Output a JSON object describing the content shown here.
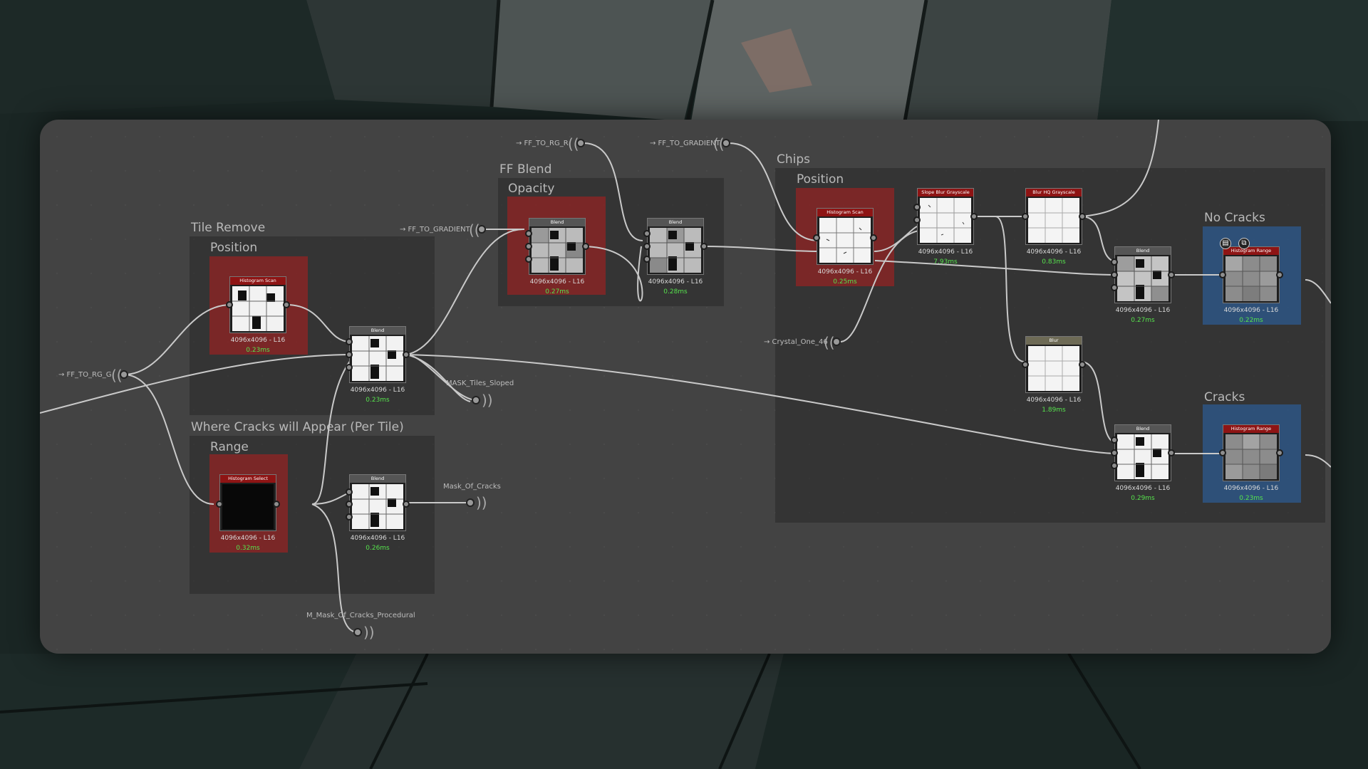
{
  "frames": {
    "tile_remove": "Tile Remove",
    "tile_remove_position": "Position",
    "cracks_appear": "Where Cracks will Appear (Per Tile)",
    "cracks_range": "Range",
    "ff_blend": "FF Blend",
    "ff_opacity": "Opacity",
    "chips": "Chips",
    "chips_position": "Position",
    "no_cracks": "No Cracks",
    "cracks": "Cracks"
  },
  "inputs": {
    "ff_to_rg_g": "→ FF_TO_RG_G",
    "ff_to_gradient_1": "→ FF_TO_GRADIENT",
    "ff_to_rg_r": "→ FF_TO_RG_R",
    "ff_to_gradient_2": "→ FF_TO_GRADIENT",
    "crystal_one": "→ Crystal_One_46"
  },
  "outputs": {
    "mask_tiles_sloped": "MASK_Tiles_Sloped",
    "mask_of_cracks": "Mask_Of_Cracks",
    "m_mask_procedural": "M_Mask_Of_Cracks_Procedural"
  },
  "nodes": {
    "hist_scan_1": {
      "title": "Histogram Scan",
      "res": "4096x4096 - L16",
      "time": "0.23ms"
    },
    "blend_1": {
      "title": "Blend",
      "res": "4096x4096 - L16",
      "time": "0.23ms"
    },
    "hist_select": {
      "title": "Histogram Select",
      "res": "4096x4096 - L16",
      "time": "0.32ms"
    },
    "blend_2": {
      "title": "Blend",
      "res": "4096x4096 - L16",
      "time": "0.26ms"
    },
    "blend_3": {
      "title": "Blend",
      "res": "4096x4096 - L16",
      "time": "0.27ms"
    },
    "blend_4": {
      "title": "Blend",
      "res": "4096x4096 - L16",
      "time": "0.28ms"
    },
    "hist_scan_2": {
      "title": "Histogram Scan",
      "res": "4096x4096 - L16",
      "time": "0.25ms"
    },
    "slope_blur": {
      "title": "Slope Blur Grayscale",
      "res": "4096x4096 - L16",
      "time": "7.93ms"
    },
    "blur_hq": {
      "title": "Blur HQ Grayscale",
      "res": "4096x4096 - L16",
      "time": "0.83ms"
    },
    "blend_5": {
      "title": "Blend",
      "res": "4096x4096 - L16",
      "time": "0.27ms"
    },
    "hist_range_1": {
      "title": "Histogram Range",
      "res": "4096x4096 - L16",
      "time": "0.22ms"
    },
    "blur": {
      "title": "Blur",
      "res": "4096x4096 - L16",
      "time": "1.89ms"
    },
    "blend_6": {
      "title": "Blend",
      "res": "4096x4096 - L16",
      "time": "0.29ms"
    },
    "hist_range_2": {
      "title": "Histogram Range",
      "res": "4096x4096 - L16",
      "time": "0.23ms"
    }
  },
  "icons": {
    "node_icon_a": "document-icon",
    "node_icon_b": "expand-icon"
  },
  "colors": {
    "frame_red": "#962222",
    "frame_blue": "#2d588c",
    "time_green": "#56e24d",
    "node_header_red": "#8e1414"
  }
}
